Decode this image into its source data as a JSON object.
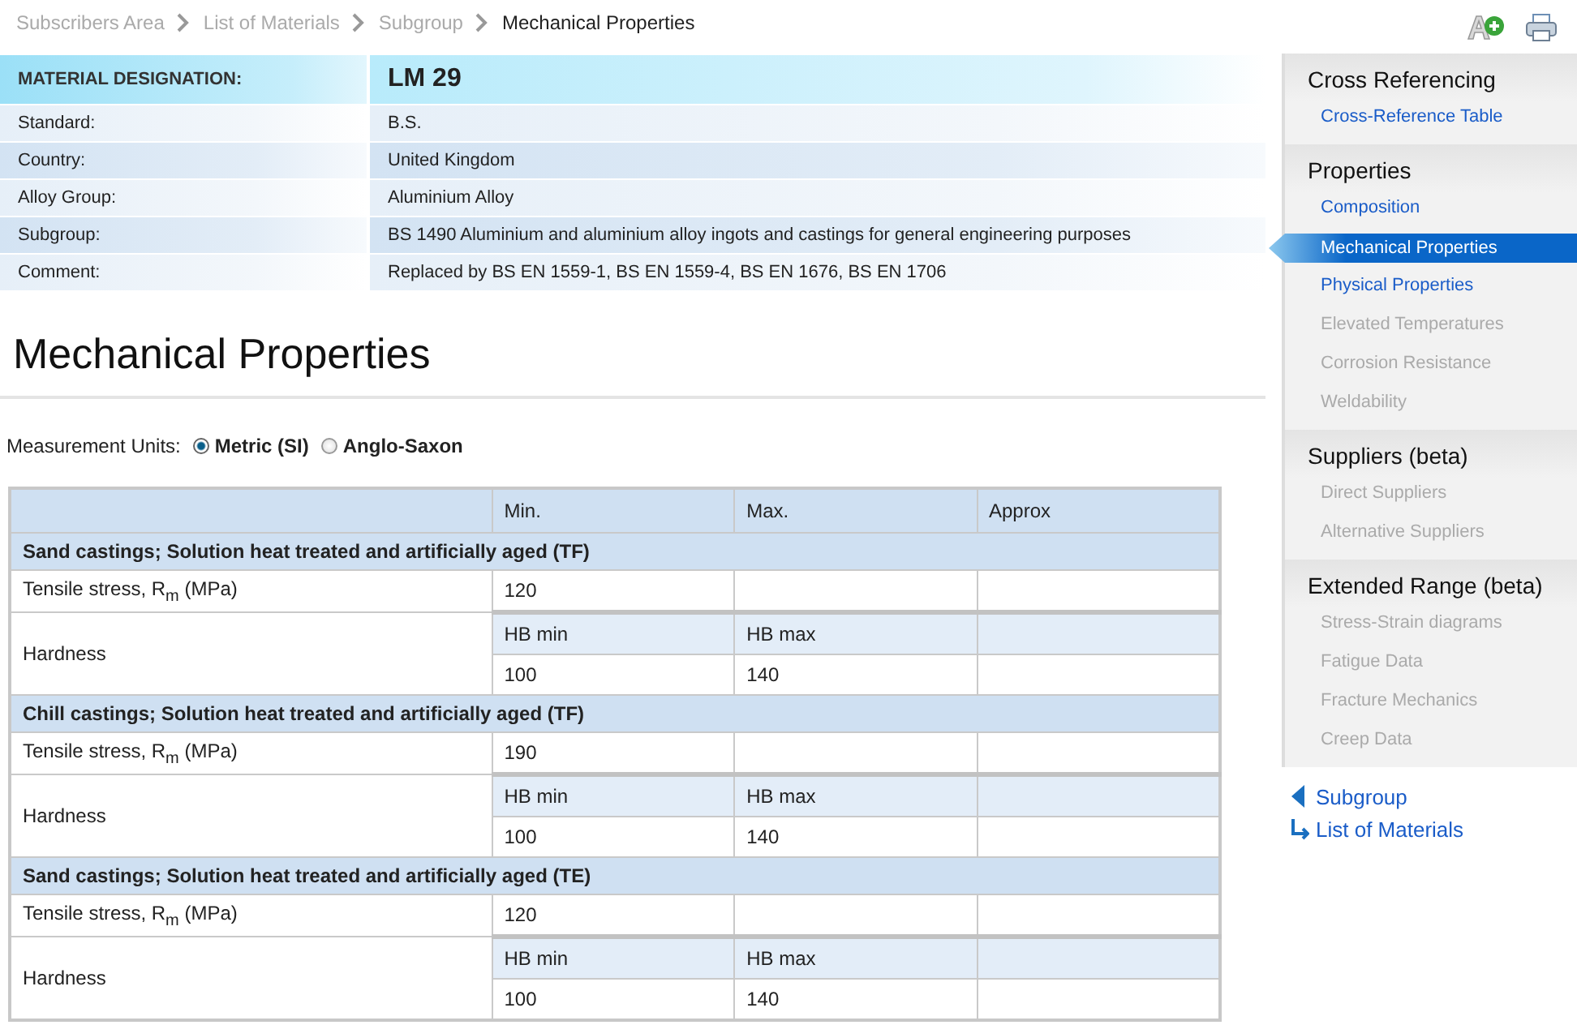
{
  "breadcrumb": [
    {
      "label": "Subscribers Area",
      "current": false
    },
    {
      "label": "List of Materials",
      "current": false
    },
    {
      "label": "Subgroup",
      "current": false
    },
    {
      "label": "Mechanical Properties",
      "current": true
    }
  ],
  "material": {
    "label": "MATERIAL DESIGNATION:",
    "value": "LM 29",
    "rows": [
      {
        "label": "Standard:",
        "value": "B.S."
      },
      {
        "label": "Country:",
        "value": "United Kingdom"
      },
      {
        "label": "Alloy Group:",
        "value": "Aluminium Alloy"
      },
      {
        "label": "Subgroup:",
        "value": "BS 1490 Aluminium and aluminium alloy ingots and castings for general engineering purposes"
      },
      {
        "label": "Comment:",
        "value": "Replaced by BS EN 1559-1, BS EN 1559-4, BS EN 1676, BS EN 1706"
      }
    ]
  },
  "heading": "Mechanical Properties",
  "units": {
    "label": "Measurement Units:",
    "options": [
      {
        "label": "Metric (SI)",
        "selected": true
      },
      {
        "label": "Anglo-Saxon",
        "selected": false
      }
    ]
  },
  "table": {
    "columns": [
      "Min.",
      "Max.",
      "Approx"
    ],
    "groups": [
      {
        "title": "Sand castings; Solution heat treated and artificially aged (TF)",
        "rows": [
          {
            "kind": "single",
            "label": "Tensile stress, R$_{m}$ (MPa)",
            "values": [
              "120"
            ]
          },
          {
            "kind": "split",
            "label": "Hardness",
            "subheaders": [
              "HB min",
              "HB max"
            ],
            "values": [
              "100",
              "140"
            ]
          }
        ]
      },
      {
        "title": "Chill castings; Solution heat treated and artificially aged (TF)",
        "rows": [
          {
            "kind": "single",
            "label": "Tensile stress, R$_{m}$ (MPa)",
            "values": [
              "190"
            ]
          },
          {
            "kind": "split",
            "label": "Hardness",
            "subheaders": [
              "HB min",
              "HB max"
            ],
            "values": [
              "100",
              "140"
            ]
          }
        ]
      },
      {
        "title": "Sand castings; Solution heat treated and artificially aged (TE)",
        "rows": [
          {
            "kind": "single",
            "label": "Tensile stress, R$_{m}$ (MPa)",
            "values": [
              "120"
            ]
          },
          {
            "kind": "split",
            "label": "Hardness",
            "subheaders": [
              "HB min",
              "HB max"
            ],
            "values": [
              "100",
              "140"
            ]
          }
        ]
      }
    ]
  },
  "sidebar": [
    {
      "title": "Cross Referencing",
      "items": [
        {
          "label": "Cross-Reference Table",
          "selected": false,
          "disabled": false
        }
      ]
    },
    {
      "title": "Properties",
      "items": [
        {
          "label": "Composition",
          "selected": false,
          "disabled": false
        },
        {
          "label": "Mechanical Properties",
          "selected": true,
          "disabled": false
        },
        {
          "label": "Physical Properties",
          "selected": false,
          "disabled": false
        },
        {
          "label": "Elevated Temperatures",
          "selected": false,
          "disabled": true
        },
        {
          "label": "Corrosion Resistance",
          "selected": false,
          "disabled": true
        },
        {
          "label": "Weldability",
          "selected": false,
          "disabled": true
        }
      ]
    },
    {
      "title": "Suppliers (beta)",
      "items": [
        {
          "label": "Direct Suppliers",
          "selected": false,
          "disabled": true
        },
        {
          "label": "Alternative Suppliers",
          "selected": false,
          "disabled": true
        }
      ]
    },
    {
      "title": "Extended Range (beta)",
      "items": [
        {
          "label": "Stress-Strain diagrams",
          "selected": false,
          "disabled": true
        },
        {
          "label": "Fatigue Data",
          "selected": false,
          "disabled": true
        },
        {
          "label": "Fracture Mechanics",
          "selected": false,
          "disabled": true
        },
        {
          "label": "Creep Data",
          "selected": false,
          "disabled": true
        }
      ]
    }
  ],
  "nav_links": [
    {
      "kind": "back",
      "label": "Subgroup"
    },
    {
      "kind": "up",
      "label": "List of Materials"
    }
  ]
}
